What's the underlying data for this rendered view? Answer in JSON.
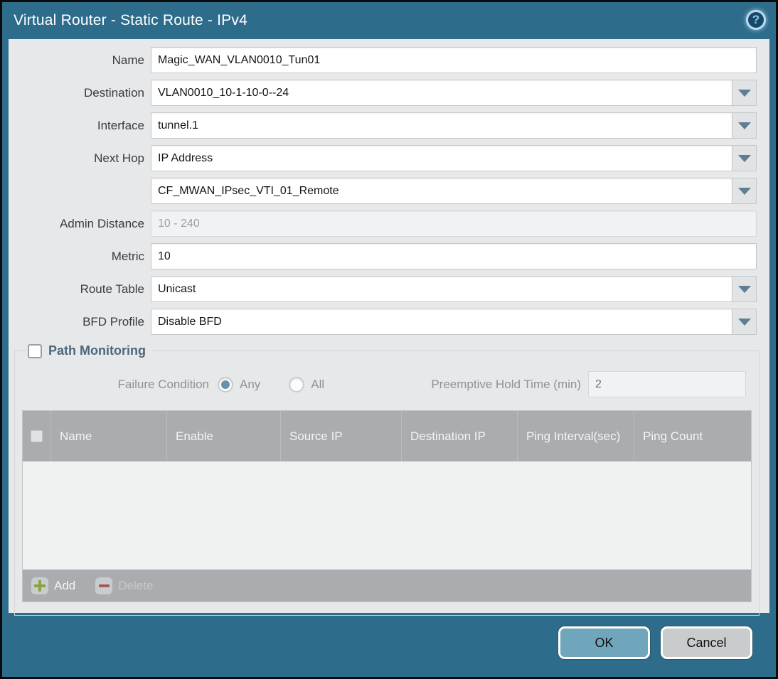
{
  "dialog": {
    "title": "Virtual Router - Static Route - IPv4",
    "help_icon": "?"
  },
  "colors": {
    "frame_teal": "#2d6c8b",
    "content_bg": "#e7e8e9",
    "ok_button": "#6fa6bb",
    "cancel_button": "#c9cccd",
    "table_header_bg": "#a9adb0",
    "dropdown_arrow": "#5d7e94",
    "section_title": "#49687c",
    "add_plus_green": "#8ba33f",
    "delete_minus_red": "#a2595c",
    "radio_selected_fill": "#6793a9"
  },
  "form": {
    "name": {
      "label": "Name",
      "value": "Magic_WAN_VLAN0010_Tun01"
    },
    "destination": {
      "label": "Destination",
      "value": "VLAN0010_10-1-10-0--24"
    },
    "interface": {
      "label": "Interface",
      "value": "tunnel.1"
    },
    "next_hop": {
      "label": "Next Hop",
      "value": "IP Address"
    },
    "next_hop_address": {
      "value": "CF_MWAN_IPsec_VTI_01_Remote"
    },
    "admin_distance": {
      "label": "Admin Distance",
      "placeholder": "10 - 240",
      "value": ""
    },
    "metric": {
      "label": "Metric",
      "value": "10"
    },
    "route_table": {
      "label": "Route Table",
      "value": "Unicast"
    },
    "bfd_profile": {
      "label": "BFD Profile",
      "value": "Disable BFD"
    }
  },
  "path_monitoring": {
    "title": "Path Monitoring",
    "enabled": false,
    "failure_condition": {
      "label": "Failure Condition",
      "options": [
        {
          "label": "Any",
          "selected": true
        },
        {
          "label": "All",
          "selected": false
        }
      ]
    },
    "preemptive_hold_time": {
      "label": "Preemptive Hold Time (min)",
      "value": "2"
    },
    "table": {
      "columns": [
        "Name",
        "Enable",
        "Source IP",
        "Destination IP",
        "Ping Interval(sec)",
        "Ping Count"
      ],
      "rows": []
    },
    "toolbar": {
      "add_label": "Add",
      "delete_label": "Delete"
    }
  },
  "footer": {
    "ok_label": "OK",
    "cancel_label": "Cancel"
  }
}
